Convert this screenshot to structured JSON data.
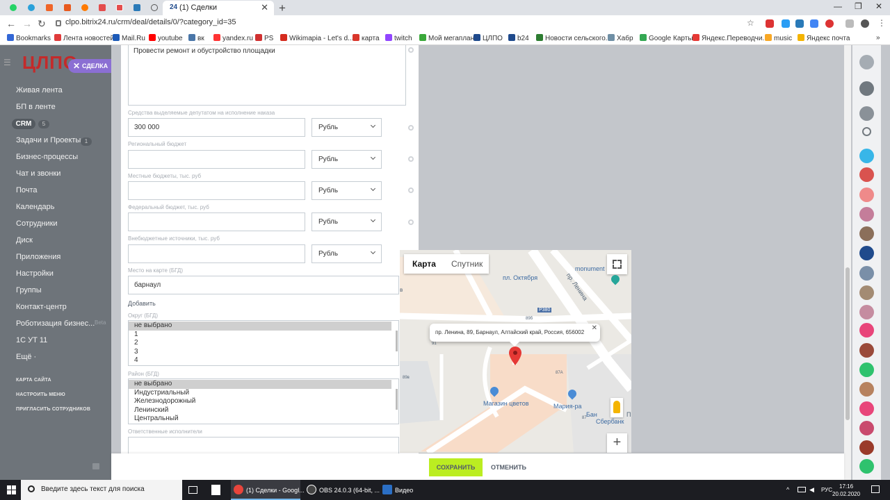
{
  "browser": {
    "active_tab": {
      "favicon": "24",
      "title": "(1) Сделки"
    },
    "url": "clpo.bitrix24.ru/crm/deal/details/0/?category_id=35",
    "pinned_tab_colors": [
      "#25d366",
      "#2aa1da",
      "#f06529",
      "#e85a1f",
      "#ff7a00",
      "#e44d4d",
      "#2a7ab8",
      "#555555"
    ]
  },
  "bookmarks": [
    {
      "label": "Bookmarks",
      "color": "#3367d6"
    },
    {
      "label": "Лента новостей",
      "color": "#e03b3b"
    },
    {
      "label": "Mail.Ru",
      "color": "#1d5ab7"
    },
    {
      "label": "youtube",
      "color": "#ff0000"
    },
    {
      "label": "вк",
      "color": "#4a76a8"
    },
    {
      "label": "yandex.ru",
      "color": "#ff3333"
    },
    {
      "label": "PS",
      "color": "#d03030"
    },
    {
      "label": "Wikimapia - Let's d...",
      "color": "#d52b1e"
    },
    {
      "label": "карта",
      "color": "#d9362b"
    },
    {
      "label": "twitch",
      "color": "#9146ff"
    },
    {
      "label": "Мой мегаплан",
      "color": "#3aa83a"
    },
    {
      "label": "ЦЛПО",
      "color": "#1f4a8c"
    },
    {
      "label": "b24",
      "color": "#1f4a8c"
    },
    {
      "label": "Новости сельского...",
      "color": "#2e7d32"
    },
    {
      "label": "Хабр",
      "color": "#6f8fa5"
    },
    {
      "label": "Google Карты",
      "color": "#34a853"
    },
    {
      "label": "Яндекс.Переводчи...",
      "color": "#e53935"
    },
    {
      "label": "music",
      "color": "#f9a825"
    },
    {
      "label": "Яндекс почта",
      "color": "#f4b400"
    }
  ],
  "left_menu": {
    "logo": "ЦЛПО",
    "deal_chip": "СДЕЛКА",
    "items": [
      {
        "label": "Живая лента"
      },
      {
        "label": "БП в ленте"
      },
      {
        "label": "CRM",
        "count": "5"
      },
      {
        "label": "Задачи и Проекты",
        "count": "1"
      },
      {
        "label": "Бизнес-процессы"
      },
      {
        "label": "Чат и звонки"
      },
      {
        "label": "Почта"
      },
      {
        "label": "Календарь"
      },
      {
        "label": "Сотрудники"
      },
      {
        "label": "Диск"
      },
      {
        "label": "Приложения"
      },
      {
        "label": "Настройки"
      },
      {
        "label": "Группы"
      },
      {
        "label": "Контакт-центр"
      },
      {
        "label": "Роботизация бизнес..."
      },
      {
        "label": "1С УТ 11"
      },
      {
        "label": "Ещё ·"
      }
    ],
    "beta": "Beta",
    "small_links": [
      "КАРТА САЙТА",
      "НАСТРОИТЬ МЕНЮ",
      "ПРИГЛАСИТЬ СОТРУДНИКОВ"
    ]
  },
  "form": {
    "textarea_value": "Провести ремонт и обустройство площадки",
    "fields": [
      {
        "label": "Средства выделяемые депутатом на исполнение наказа",
        "value": "300 000",
        "currency": "Рубль"
      },
      {
        "label": "Региональный бюджет",
        "value": "",
        "currency": "Рубль"
      },
      {
        "label": "Местные бюджеты, тыс. руб",
        "value": "",
        "currency": "Рубль"
      },
      {
        "label": "Федеральный бюджет, тыс. руб",
        "value": "",
        "currency": "Рубль"
      },
      {
        "label": "Внебюджетные источники, тыс. руб",
        "value": "",
        "currency": "Рубль"
      }
    ],
    "map_place": {
      "label": "Место на карте (БГД)",
      "value": "барнаул"
    },
    "add_label": "Добавить",
    "district": {
      "label": "Округ (БГД)",
      "options": [
        "не выбрано",
        "1",
        "2",
        "3",
        "4"
      ]
    },
    "area": {
      "label": "Район (БГД)",
      "options": [
        "не выбрано",
        "Индустриальный",
        "Железнодорожный",
        "Ленинский",
        "Центральный"
      ]
    },
    "responsible_label": "Ответственные исполнители"
  },
  "map": {
    "tab_map": "Карта",
    "tab_satellite": "Спутник",
    "address": "пр. Ленина, 89, Барнаул, Алтайский край, Россия, 656002",
    "labels": {
      "square": "пл. Октября",
      "prospect": "пр. Ленина",
      "monument": "monument",
      "road": "Р380",
      "shop": "Магазин цветов",
      "maria": "Мария-ра",
      "sber1": "Бан",
      "sber2": "Сбербанк",
      "n89b": "89б",
      "n91": "91",
      "n89v": "89в",
      "n87a": "87А",
      "n87": "87",
      "p": "П",
      "v": "в"
    }
  },
  "footer": {
    "save": "СОХРАНИТЬ",
    "cancel": "ОТМЕНИТЬ"
  },
  "taskbar": {
    "search_placeholder": "Введите здесь текст для поиска",
    "apps": [
      {
        "label": "(1) Сделки - Googl...",
        "color": "#e8453c"
      },
      {
        "label": "OBS 24.0.3 (64-bit, ...",
        "color": "#444444"
      },
      {
        "label": "Видео",
        "color": "#2b6fc5"
      }
    ],
    "lang": "РУС",
    "time": "17:16",
    "date": "20.02.2020"
  },
  "right_bar_colors": [
    "#d9534f",
    "#ef8a8a",
    "#c47d9a",
    "#8b6f5a",
    "#1f4a8c",
    "#7a8fa8",
    "#a38b73",
    "#c58ca0",
    "#e8457a",
    "#9a4a3a",
    "#2fc26e",
    "#b7825f",
    "#e8457a",
    "#c94a6e",
    "#9a3a2a",
    "#2fc26e"
  ]
}
